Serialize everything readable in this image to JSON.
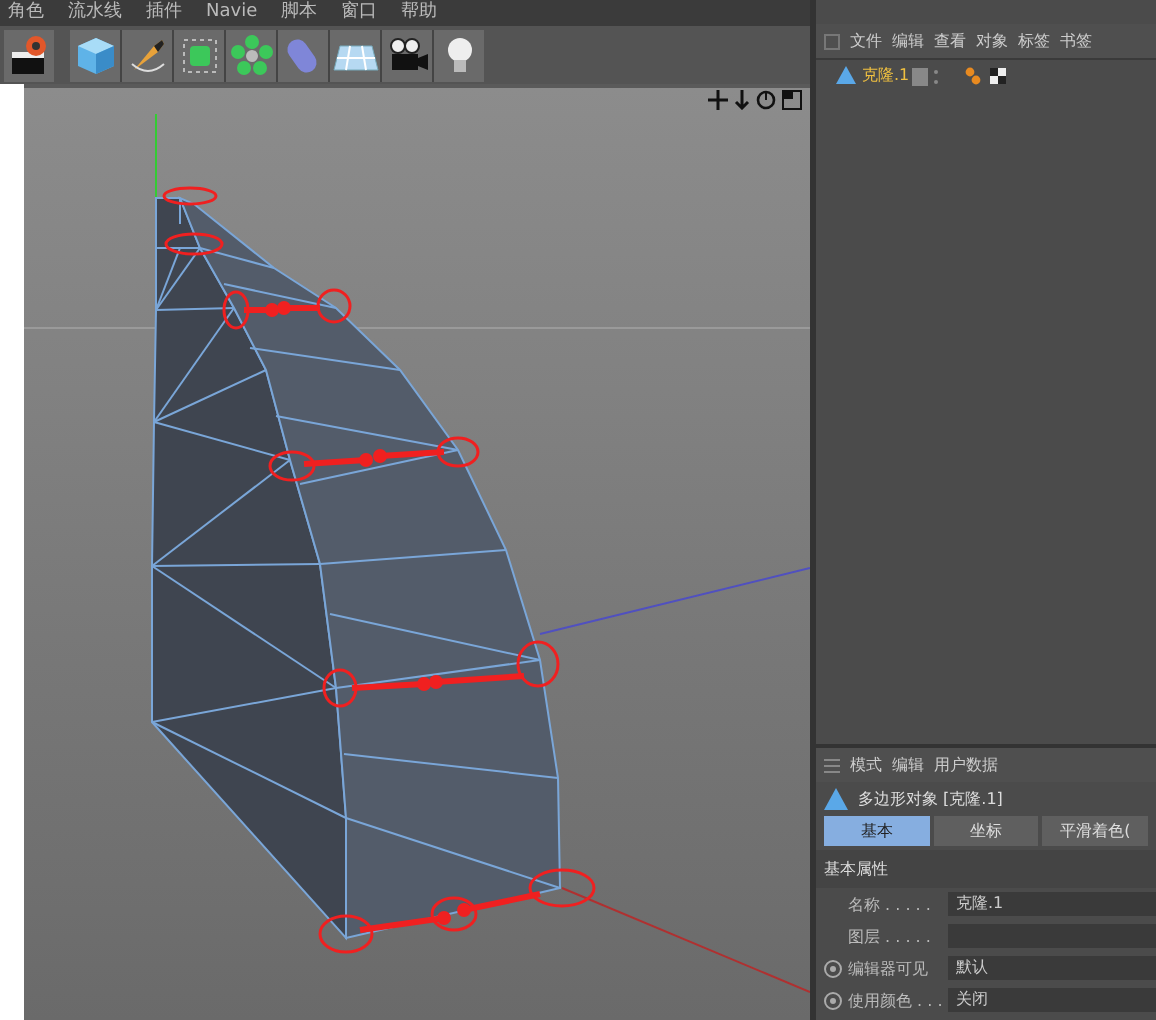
{
  "menu_bar": [
    "角色",
    "流水线",
    "插件",
    "Navie",
    "脚本",
    "窗口",
    "帮助"
  ],
  "object_manager": {
    "menu": [
      "文件",
      "编辑",
      "查看",
      "对象",
      "标签",
      "书签"
    ],
    "objects": [
      {
        "name": "克隆.1",
        "selected": true
      }
    ]
  },
  "attribute_manager": {
    "menu": [
      "模式",
      "编辑",
      "用户数据"
    ],
    "title": "多边形对象 [克隆.1]",
    "tabs": [
      {
        "label": "基本",
        "selected": true
      },
      {
        "label": "坐标",
        "selected": false
      },
      {
        "label": "平滑着色(",
        "selected": false
      }
    ],
    "section": "基本属性",
    "fields": [
      {
        "label": "名称 . . . . .",
        "value": "克隆.1",
        "kind": "text"
      },
      {
        "label": "图层 . . . . .",
        "kind": "text"
      },
      {
        "label": "编辑器可见",
        "value": "默认",
        "kind": "radio",
        "checked": true
      },
      {
        "label": "使用颜色 . . .",
        "value": "关闭",
        "kind": "radio",
        "checked": true
      }
    ]
  }
}
